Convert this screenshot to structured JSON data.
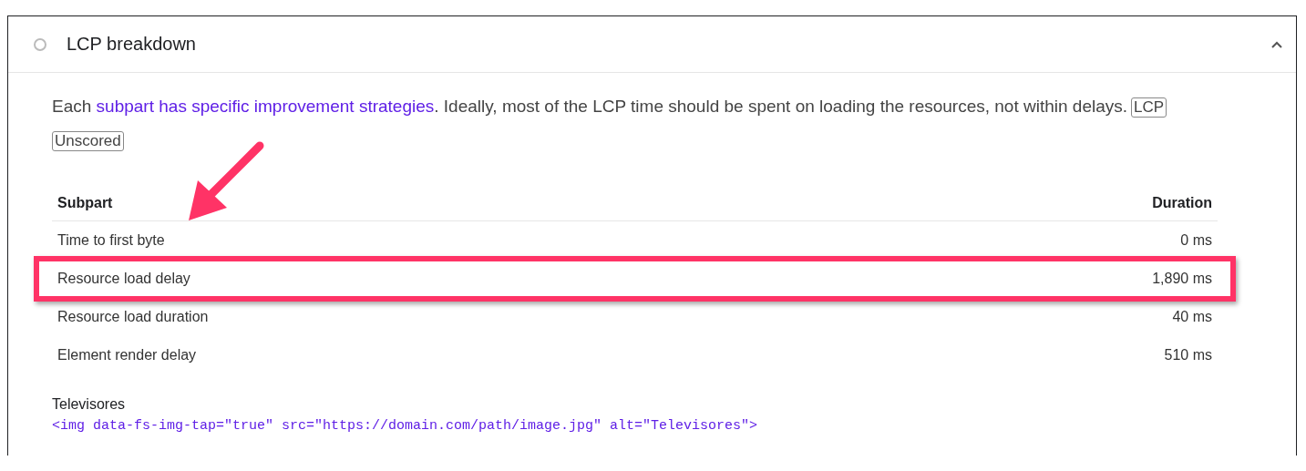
{
  "audit": {
    "title": "LCP breakdown",
    "expanded": true,
    "description": {
      "before": "Each ",
      "link": "subpart has specific improvement strategies",
      "after": ". Ideally, most of the LCP time should be spent on loading the resources, not within delays."
    },
    "badges": [
      "LCP",
      "Unscored"
    ],
    "table": {
      "columns": [
        "Subpart",
        "Duration"
      ],
      "rows": [
        {
          "subpart": "Time to first byte",
          "duration": "0 ms",
          "highlighted": false
        },
        {
          "subpart": "Resource load delay",
          "duration": "1,890 ms",
          "highlighted": true
        },
        {
          "subpart": "Resource load duration",
          "duration": "40 ms",
          "highlighted": false
        },
        {
          "subpart": "Element render delay",
          "duration": "510 ms",
          "highlighted": false
        }
      ]
    },
    "node": {
      "label": "Televisores",
      "snippet": "<img data-fs-img-tap=\"true\" src=\"https://domain.com/path/image.jpg\" alt=\"Televisores\">"
    }
  }
}
